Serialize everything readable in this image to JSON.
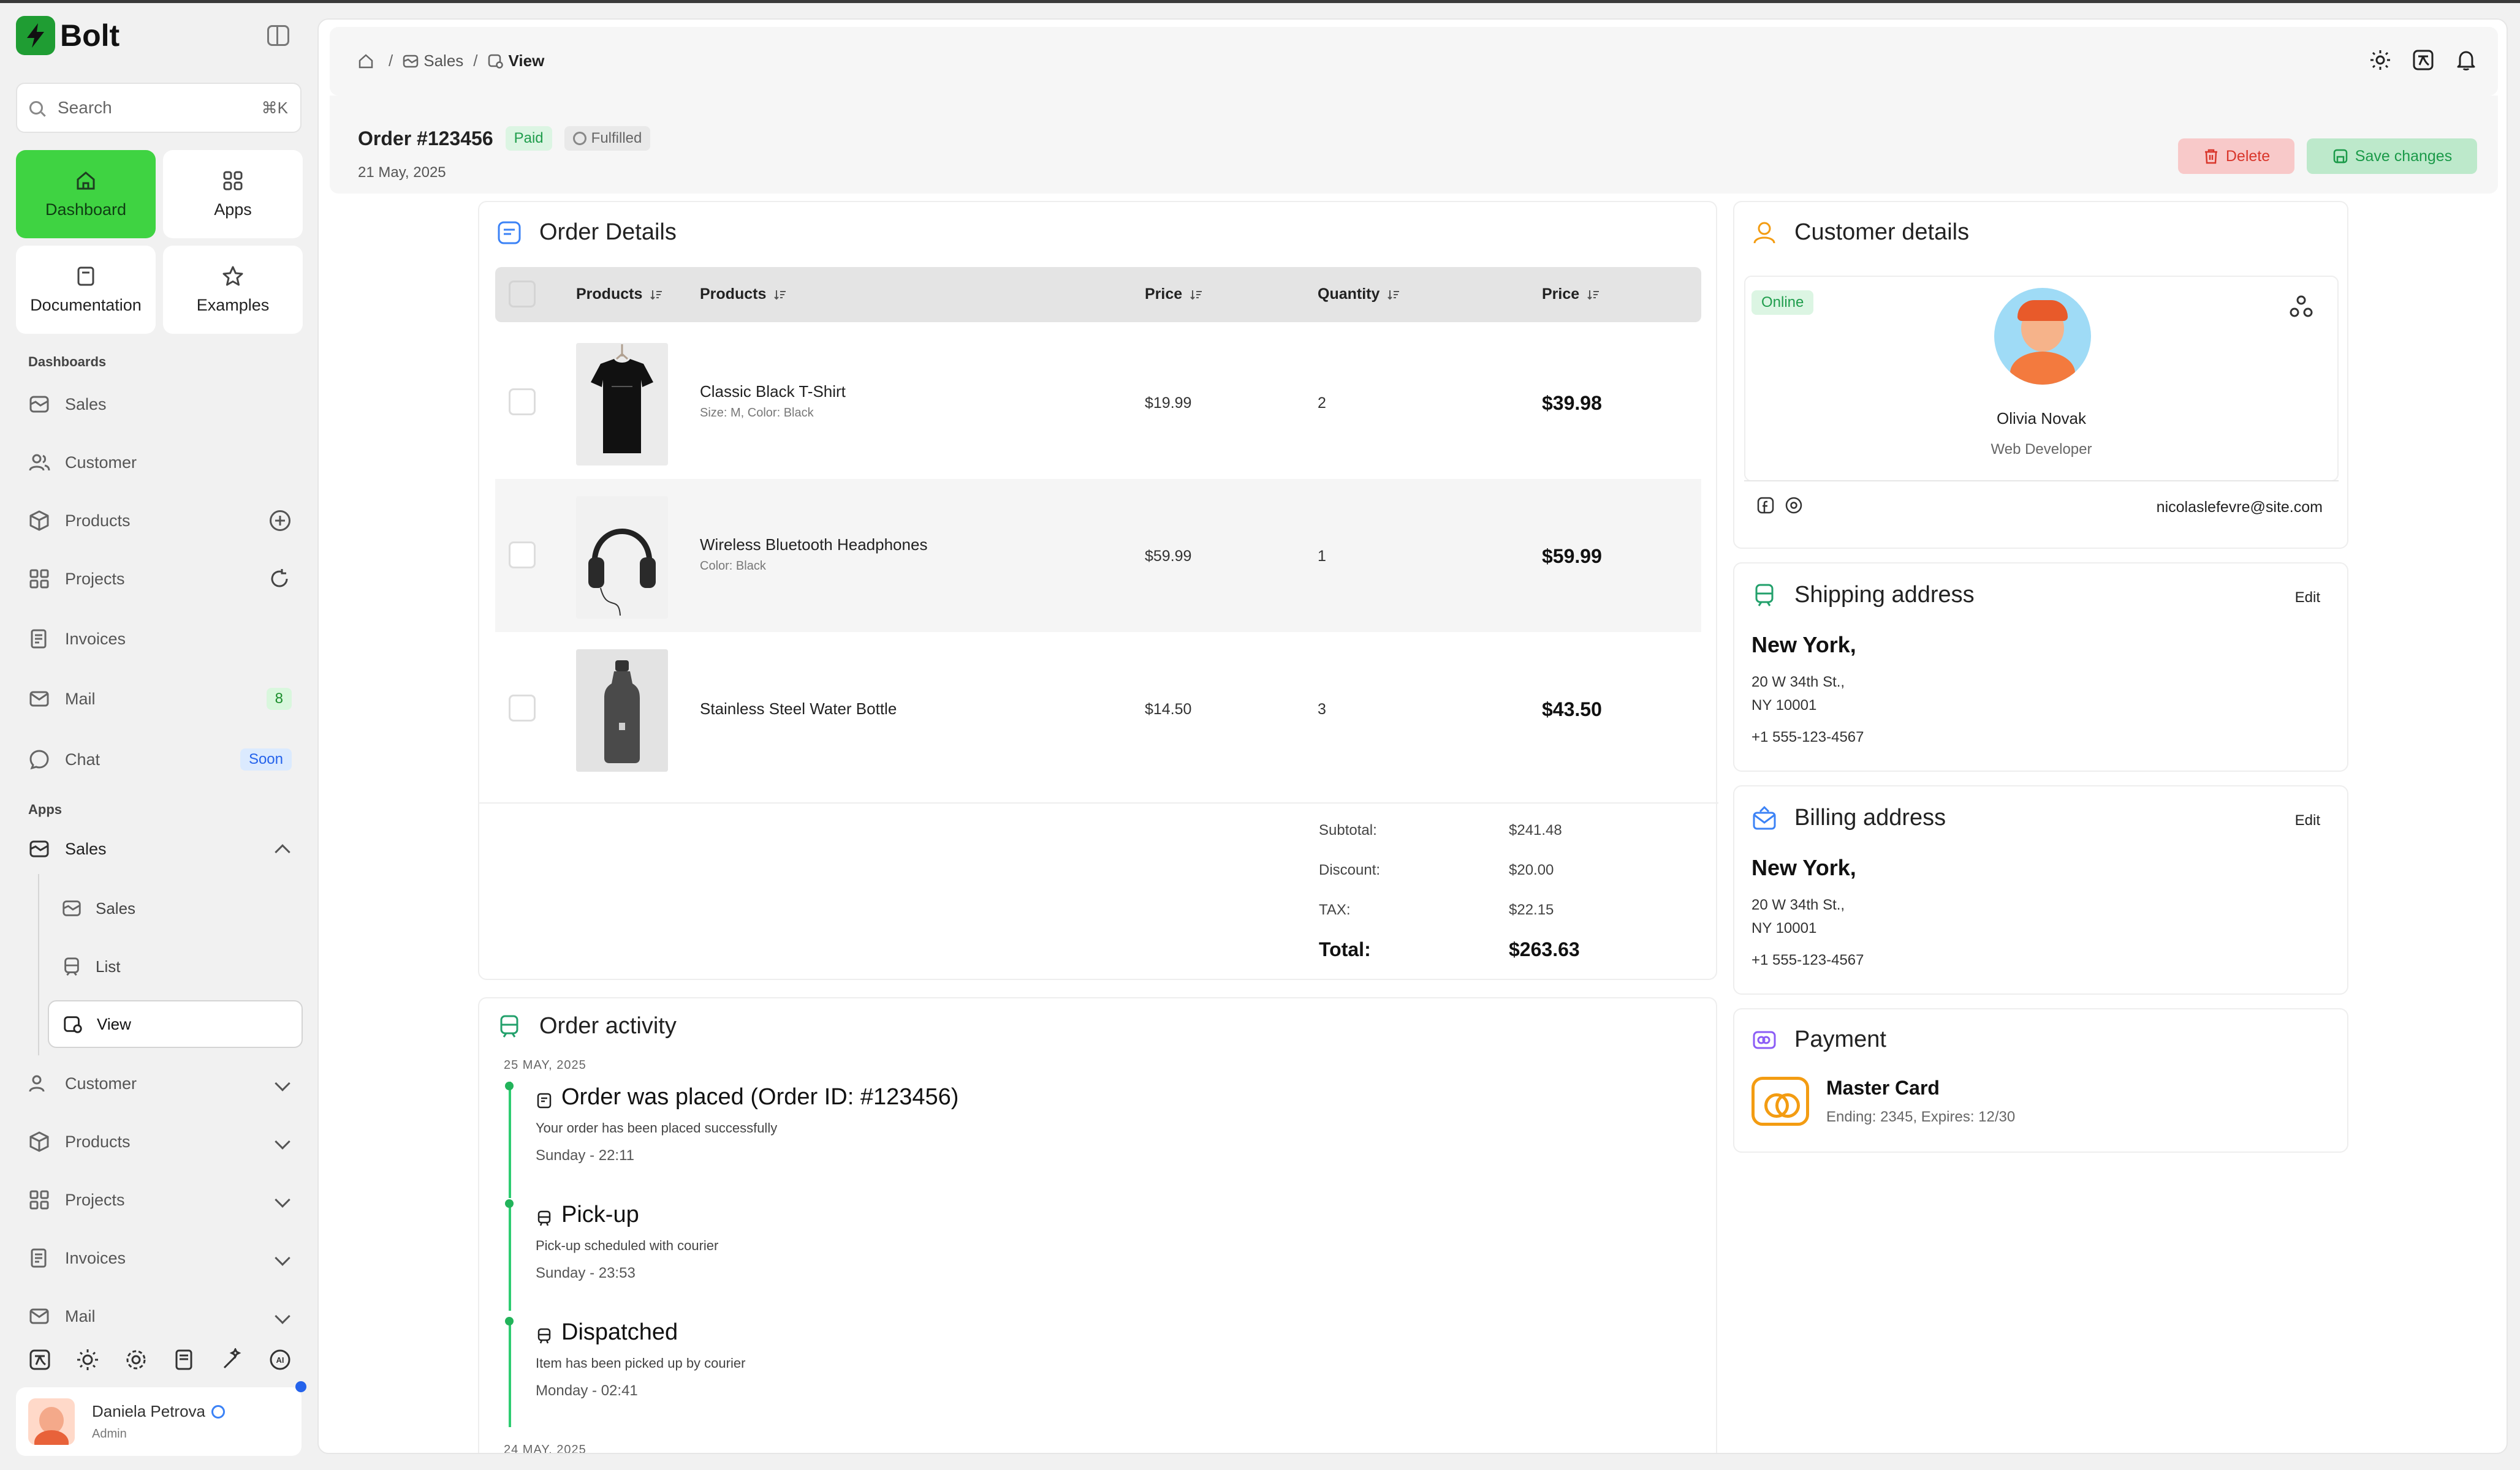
{
  "app": {
    "name": "Bolt"
  },
  "search": {
    "placeholder": "Search",
    "shortcut": "⌘K"
  },
  "tiles": [
    {
      "label": "Dashboard",
      "icon": "home-icon",
      "active": true
    },
    {
      "label": "Apps",
      "icon": "grid-icon"
    },
    {
      "label": "Documentation",
      "icon": "book-icon"
    },
    {
      "label": "Examples",
      "icon": "star-icon"
    }
  ],
  "sidebar": {
    "dashboards_label": "Dashboards",
    "dashboards": [
      {
        "label": "Sales",
        "icon": "chart-card-icon"
      },
      {
        "label": "Customer",
        "icon": "users-icon"
      },
      {
        "label": "Products",
        "icon": "box-icon",
        "action": "plus-circle-icon"
      },
      {
        "label": "Projects",
        "icon": "grid-icon",
        "action": "refresh-icon"
      },
      {
        "label": "Invoices",
        "icon": "invoice-icon"
      },
      {
        "label": "Mail",
        "icon": "mail-icon",
        "badge": "8"
      },
      {
        "label": "Chat",
        "icon": "chat-icon",
        "badge": "Soon"
      }
    ],
    "apps_label": "Apps",
    "apps": [
      {
        "label": "Sales",
        "icon": "chart-card-icon",
        "expanded": true
      },
      {
        "label": "Customer",
        "icon": "users-icon"
      },
      {
        "label": "Products",
        "icon": "box-icon"
      },
      {
        "label": "Projects",
        "icon": "grid-icon"
      },
      {
        "label": "Invoices",
        "icon": "invoice-icon"
      },
      {
        "label": "Mail",
        "icon": "mail-icon"
      }
    ],
    "sales_sub": [
      {
        "label": "Sales",
        "icon": "chart-card-icon"
      },
      {
        "label": "List",
        "icon": "train-icon"
      },
      {
        "label": "View",
        "icon": "view-icon",
        "active": true
      }
    ]
  },
  "bottom_icons": [
    "translate-icon",
    "sun-icon",
    "settings-icon",
    "notebook-icon",
    "magic-wand-icon",
    "ai-icon"
  ],
  "user": {
    "name": "Daniela Petrova",
    "role": "Admin"
  },
  "breadcrumb": {
    "sales": "Sales",
    "current": "View",
    "sep": "/"
  },
  "topbar_icons": [
    "sun-icon",
    "translate-icon",
    "bell-icon"
  ],
  "order": {
    "title": "Order #123456",
    "paid": "Paid",
    "fulfilled": "Fulfilled",
    "date": "21 May, 2025",
    "delete_label": "Delete",
    "save_label": "Save changes"
  },
  "order_details": {
    "title": "Order Details",
    "columns": [
      "Products",
      "Products",
      "Price",
      "Quantity",
      "Price"
    ],
    "rows": [
      {
        "name": "Classic Black T-Shirt",
        "meta": "Size: M, Color: Black",
        "price": "$19.99",
        "qty": "2",
        "total": "$39.98"
      },
      {
        "name": "Wireless Bluetooth Headphones",
        "meta": "Color: Black",
        "price": "$59.99",
        "qty": "1",
        "total": "$59.99"
      },
      {
        "name": "Stainless Steel Water Bottle",
        "meta": "",
        "price": "$14.50",
        "qty": "3",
        "total": "$43.50"
      }
    ],
    "summary": {
      "subtotal_label": "Subtotal:",
      "subtotal": "$241.48",
      "discount_label": "Discount:",
      "discount": "$20.00",
      "tax_label": "TAX:",
      "tax": "$22.15",
      "total_label": "Total:",
      "total": "$263.63"
    }
  },
  "activity": {
    "title": "Order activity",
    "date1": "25 MAY, 2025",
    "date2": "24 MAY, 2025",
    "events": [
      {
        "title": "Order was placed (Order ID: #123456)",
        "desc": "Your order has been placed successfully",
        "time": "Sunday - 22:11"
      },
      {
        "title": "Pick-up",
        "desc": "Pick-up scheduled with courier",
        "time": "Sunday - 23:53"
      },
      {
        "title": "Dispatched",
        "desc": "Item has been picked up by courier",
        "time": "Monday - 02:41"
      }
    ]
  },
  "customer": {
    "title": "Customer details",
    "status": "Online",
    "name": "Olivia Novak",
    "role": "Web Developer",
    "email": "nicolaslefevre@site.com"
  },
  "shipping": {
    "title": "Shipping address",
    "edit": "Edit",
    "city": "New York,",
    "line1": "20 W 34th St.,",
    "line2": "NY 10001",
    "phone": "+1 555-123-4567"
  },
  "billing": {
    "title": "Billing address",
    "edit": "Edit",
    "city": "New York,",
    "line1": "20 W 34th St.,",
    "line2": "NY 10001",
    "phone": "+1 555-123-4567"
  },
  "payment": {
    "title": "Payment",
    "card": "Master Card",
    "meta": "Ending: 2345, Expires: 12/30"
  },
  "colors": {
    "accent": "#3fd342",
    "brand": "#1f9d33",
    "danger": "#d9362b",
    "success": "#1b9a49"
  }
}
